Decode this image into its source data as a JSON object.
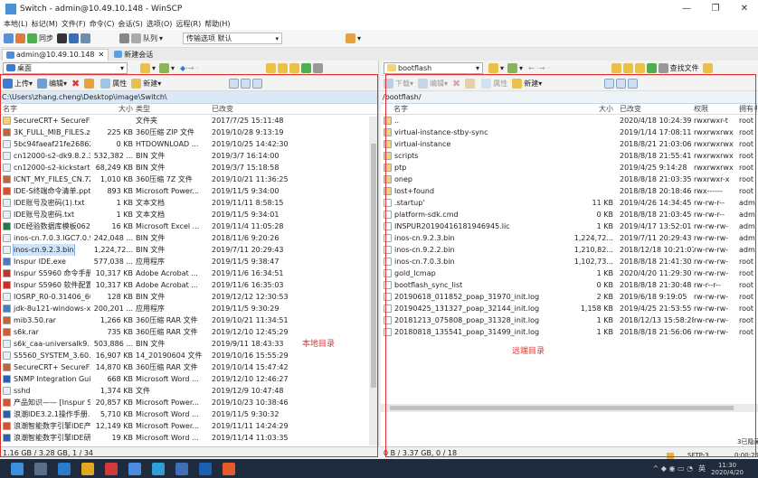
{
  "window": {
    "title": "Switch - admin@10.49.10.148 - WinSCP",
    "minimize": "—",
    "maximize": "❐",
    "close": "✕"
  },
  "menu": [
    "本地(L)",
    "标记(M)",
    "文件(F)",
    "命令(C)",
    "会话(S)",
    "选项(O)",
    "远程(R)",
    "帮助(H)"
  ],
  "toolbar": {
    "sync": "同步",
    "queue": "队列",
    "transfer_label": "传输选项 默认"
  },
  "tabs": [
    "admin@10.49.10.148",
    "新建会话"
  ],
  "left": {
    "drive": "桌面",
    "actions": {
      "upload": "上传",
      "edit": "编辑",
      "props": "属性",
      "new": "新建"
    },
    "path": "C:\\Users\\zhang.cheng\\Desktop\\image\\Switch\\",
    "columns": [
      "名字",
      "大小",
      "类型",
      "已改变"
    ],
    "rows": [
      [
        "SecureCRT+ SecureFX 7.0...",
        "",
        "文件夹",
        "2017/7/25 15:11:48"
      ],
      [
        "3K_FULL_MIB_FILES.zip",
        "225 KB",
        "360压缩 ZIP 文件",
        "2019/10/28 9:13:19"
      ],
      [
        "5bc94faeaf21fe2686241b...",
        "0 KB",
        "HTDOWNLOAD ...",
        "2019/10/25 14:42:30"
      ],
      [
        "cn12000-s2-dk9.8.2.3.bin",
        "532,382 ...",
        "BIN 文件",
        "2019/3/7 16:14:00"
      ],
      [
        "cn12000-s2-kickstart.8.2.3...",
        "68,249 KB",
        "BIN 文件",
        "2019/3/7 15:18:58"
      ],
      [
        "ICNT_MY_FILES_CN.7Z",
        "1,010 KB",
        "360压缩 7Z 文件",
        "2019/10/21 11:36:25"
      ],
      [
        "IDE-S终端命令清单.pptx",
        "893 KB",
        "Microsoft Power...",
        "2019/11/5 9:34:00"
      ],
      [
        "IDE账号及密码(1).txt",
        "1 KB",
        "文本文档",
        "2019/11/11 8:58:15"
      ],
      [
        "IDE账号及密码.txt",
        "1 KB",
        "文本文档",
        "2019/11/5 9:34:01"
      ],
      [
        "IDE经验数据库模板0620.xlsx",
        "16 KB",
        "Microsoft Excel ...",
        "2019/11/4 11:05:28"
      ],
      [
        "inos-cn.7.0.3.IGC7.0.94.bin",
        "242,048 ...",
        "BIN 文件",
        "2018/11/6 9:20:26"
      ],
      [
        "inos-cn.9.2.3.bin",
        "1,224,72...",
        "BIN 文件",
        "2019/7/11 20:29:43"
      ],
      [
        "Inspur IDE.exe",
        "577,038 ...",
        "应用程序",
        "2019/11/5 9:38:47"
      ],
      [
        "Inspur S5960 命令手册-V1....",
        "10,317 KB",
        "Adobe Acrobat ...",
        "2019/11/6 16:34:51"
      ],
      [
        "Inspur S5960 软件配置指南...",
        "10,317 KB",
        "Adobe Acrobat ...",
        "2019/11/6 16:35:03"
      ],
      [
        "IOSRP_R0-0.31406_6085.2...",
        "128 KB",
        "BIN 文件",
        "2019/12/12 12:30:53"
      ],
      [
        "jdk-8u121-windows-x64.exe",
        "200,201 ...",
        "应用程序",
        "2019/11/5 9:30:29"
      ],
      [
        "mib3.50.rar",
        "1,266 KB",
        "360压缩 RAR 文件",
        "2019/10/21 11:34:51"
      ],
      [
        "s6k.rar",
        "735 KB",
        "360压缩 RAR 文件",
        "2019/12/10 12:45:29"
      ],
      [
        "s6k_caa-universalk9.11.03...",
        "503,886 ...",
        "BIN 文件",
        "2019/9/11 18:43:33"
      ],
      [
        "S5560_SYSTEM_3.60.14_20...",
        "16,907 KB",
        "14_20190604 文件",
        "2019/10/16 15:55:29"
      ],
      [
        "SecureCRT+ SecureFX 7.0...",
        "14,870 KB",
        "360压缩 RAR 文件",
        "2019/10/14 15:47:42"
      ],
      [
        "SNMP Integration Guide ...",
        "668 KB",
        "Microsoft Word ...",
        "2019/12/10 12:46:27"
      ],
      [
        "sshd",
        "1,374 KB",
        "文件",
        "2019/12/9 10:47:48"
      ],
      [
        "产品知识—— [Inspur S...",
        "20,857 KB",
        "Microsoft Power...",
        "2019/10/23 10:38:46"
      ],
      [
        "浪潮IDE3.2.1操作手册.doc",
        "5,710 KB",
        "Microsoft Word ...",
        "2019/11/5 9:30:32"
      ],
      [
        "浪潮智能数字引擎IDE产品介...",
        "12,149 KB",
        "Microsoft Power...",
        "2019/11/11 14:24:29"
      ],
      [
        "浪潮智能数字引擎IDE研拓扑...",
        "19 KB",
        "Microsoft Word ...",
        "2019/11/14 11:03:35"
      ]
    ],
    "status": "1.16 GB / 3.28 GB, 1 / 34",
    "annotation": "本地目录"
  },
  "right": {
    "drive": "bootflash",
    "find": "查找文件",
    "actions": {
      "download": "下载",
      "edit": "编辑",
      "props": "属性",
      "new": "新建"
    },
    "path": "/bootflash/",
    "columns": [
      "名字",
      "大小",
      "已改变",
      "权限",
      "拥有者"
    ],
    "rows": [
      [
        "..",
        "",
        "2020/4/18 10:24:39",
        "rwxrwxr-t",
        "root"
      ],
      [
        "virtual-instance-stby-sync",
        "",
        "2019/1/14 17:08:11",
        "rwxrwxrwx",
        "root"
      ],
      [
        "virtual-instance",
        "",
        "2018/8/21 21:03:06",
        "rwxrwxrwx",
        "root"
      ],
      [
        "scripts",
        "",
        "2018/8/18 21:55:41",
        "rwxrwxrwx",
        "root"
      ],
      [
        "ptp",
        "",
        "2019/4/25 9:14:28",
        "rwxrwxrwx",
        "root"
      ],
      [
        "onep",
        "",
        "2018/8/18 21:03:35",
        "rwxrwxr-x",
        "root"
      ],
      [
        "lost+found",
        "",
        "2018/8/18 20:18:46",
        "rwx------",
        "root"
      ],
      [
        ".startup'",
        "11 KB",
        "2019/4/26 14:34:45",
        "rw-rw-r--",
        "adm"
      ],
      [
        "platform-sdk.cmd",
        "0 KB",
        "2018/8/18 21:03:45",
        "rw-rw-r--",
        "adm"
      ],
      [
        "INSPUR20190416181946945.lic",
        "1 KB",
        "2019/4/17 13:52:01",
        "rw-rw-rw-",
        "adm"
      ],
      [
        "inos-cn.9.2.3.bin",
        "1,224,72...",
        "2019/7/11 20:29:43",
        "rw-rw-rw-",
        "adm"
      ],
      [
        "inos-cn.9.2.2.bin",
        "1,210,82...",
        "2018/12/18 10:21:07",
        "rw-rw-rw-",
        "adm"
      ],
      [
        "inos-cn.7.0.3.bin",
        "1,102,73...",
        "2018/8/18 21:41:30",
        "rw-rw-rw-",
        "root"
      ],
      [
        "gold_lcmap",
        "1 KB",
        "2020/4/20 11:29:30",
        "rw-rw-rw-",
        "root"
      ],
      [
        "bootflash_sync_list",
        "0 KB",
        "2018/8/18 21:30:48",
        "rw-r--r--",
        "root"
      ],
      [
        "20190618_011852_poap_31970_init.log",
        "2 KB",
        "2019/6/18 9:19:05",
        "rw-rw-rw-",
        "root"
      ],
      [
        "20190425_131327_poap_32144_init.log",
        "1,158 KB",
        "2019/4/25 21:53:55",
        "rw-rw-rw-",
        "root"
      ],
      [
        "20181213_075808_poap_31328_init.log",
        "1 KB",
        "2018/12/13 15:58:28",
        "rw-rw-rw-",
        "root"
      ],
      [
        "20180818_135541_poap_31499_init.log",
        "1 KB",
        "2018/8/18 21:56:06",
        "rw-rw-rw-",
        "root"
      ]
    ],
    "status": "0 B / 3.37 GB, 0 / 18",
    "annotation": "远端目录"
  },
  "sys": {
    "protocol": "SFTP-3",
    "elapsed": "0:00:25",
    "time": "11:30",
    "date": "2020/4/20",
    "count": "3已隐藏",
    "ime": "英"
  },
  "colors": {
    "folder": "#f4d27a",
    "file": "#ffffff",
    "annotation": "#e0302e",
    "selection": "#cde4fb",
    "path_bg": "#dbe9f7"
  }
}
